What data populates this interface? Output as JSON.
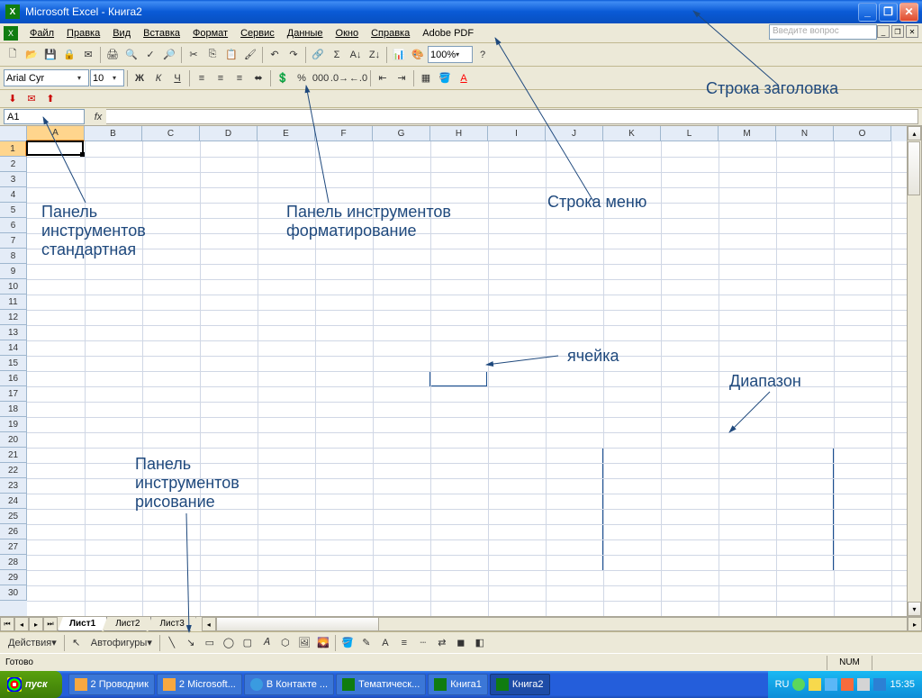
{
  "title": "Microsoft Excel - Книга2",
  "help_placeholder": "Введите вопрос",
  "menus": [
    "Файл",
    "Правка",
    "Вид",
    "Вставка",
    "Формат",
    "Сервис",
    "Данные",
    "Окно",
    "Справка",
    "Adobe PDF"
  ],
  "font_name": "Arial Cyr",
  "font_size": "10",
  "zoom": "100%",
  "name_box": "A1",
  "columns": [
    "A",
    "B",
    "C",
    "D",
    "E",
    "F",
    "G",
    "H",
    "I",
    "J",
    "K",
    "L",
    "M",
    "N",
    "O"
  ],
  "row_count": 30,
  "sheets": [
    "Лист1",
    "Лист2",
    "Лист3"
  ],
  "draw_actions": "Действия",
  "autoshapes": "Автофигуры",
  "status_ready": "Готово",
  "status_num": "NUM",
  "start_label": "пуск",
  "taskbar": [
    {
      "label": "2 Проводник",
      "type": "folder"
    },
    {
      "label": "2 Microsoft...",
      "type": "pp"
    },
    {
      "label": "В Контакте ...",
      "type": "ie"
    },
    {
      "label": "Тематическ...",
      "type": "excel"
    },
    {
      "label": "Книга1",
      "type": "excel"
    },
    {
      "label": "Книга2",
      "type": "excel",
      "active": true
    }
  ],
  "tray_lang": "RU",
  "tray_time": "15:35",
  "annotations": {
    "titlebar": "Строка заголовка",
    "menubar": "Строка меню",
    "std_toolbar": "Панель инструментов стандартная",
    "fmt_toolbar": "Панель инструментов форматирование",
    "draw_toolbar": "Панель инструментов рисование",
    "cell": "ячейка",
    "range": "Диапазон"
  }
}
